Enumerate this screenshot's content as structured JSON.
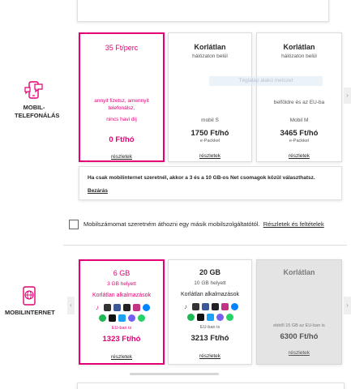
{
  "mobile_calls": {
    "category_label_line1": "MOBIL-",
    "category_label_line2": "TELEFONÁLÁS",
    "cards": [
      {
        "title": "35 Ft/perc",
        "desc_line1": "annyit fizetsz, amennyit",
        "desc_line2": "telefonálsz,",
        "desc_line3": "nincs havi díj",
        "price": "0 Ft/hó",
        "link": "részletek"
      },
      {
        "title": "Korlátlan",
        "subtitle": "hálózaton belül",
        "plan": "mobil S",
        "price": "1750 Ft/hó",
        "price_note": "e-Packkel",
        "link": "részletek"
      },
      {
        "title": "Korlátlan",
        "subtitle": "hálózaton belül",
        "desc": "belföldre és az EU-ba",
        "plan": "Mobil M",
        "price": "3465 Ft/hó",
        "price_note": "e-Packkel",
        "link": "részletek"
      }
    ],
    "watermark": "Téglalap alakú metszet",
    "info_text": "Ha csak mobilinternet szeretnél, akkor a 3 és a 10 GB-os Net csomagok közül választhatsz.",
    "close_link": "Bezárás"
  },
  "port_option": {
    "label": "Mobilszámomat szeretném áthozni egy másik mobilszolgáltatótól.",
    "link": "Részletek és feltételek"
  },
  "mobile_internet": {
    "category_label": "MOBILINTERNET",
    "cards": [
      {
        "title": "6 GB",
        "subtitle": "3 GB helyett",
        "apps_title": "Korlátlan alkalmazások",
        "eu_note": "EU-ban is",
        "price": "1323 Ft/hó",
        "link": "részletek"
      },
      {
        "title": "20 GB",
        "subtitle": "10 GB helyett",
        "apps_title": "Korlátlan alkalmazások",
        "eu_note": "EU-ban is",
        "price": "3213 Ft/hó",
        "link": "részletek"
      },
      {
        "title": "Korlátlan",
        "desc": "ebből 15 GB az EU-ban is",
        "price": "6300 Ft/hó",
        "link": "részletek"
      }
    ]
  },
  "nav": {
    "prev_symbol": "‹",
    "next_symbol": "›"
  },
  "colors": {
    "accent": "#e20074",
    "text": "#262626",
    "disabled": "#e4e4e4"
  }
}
